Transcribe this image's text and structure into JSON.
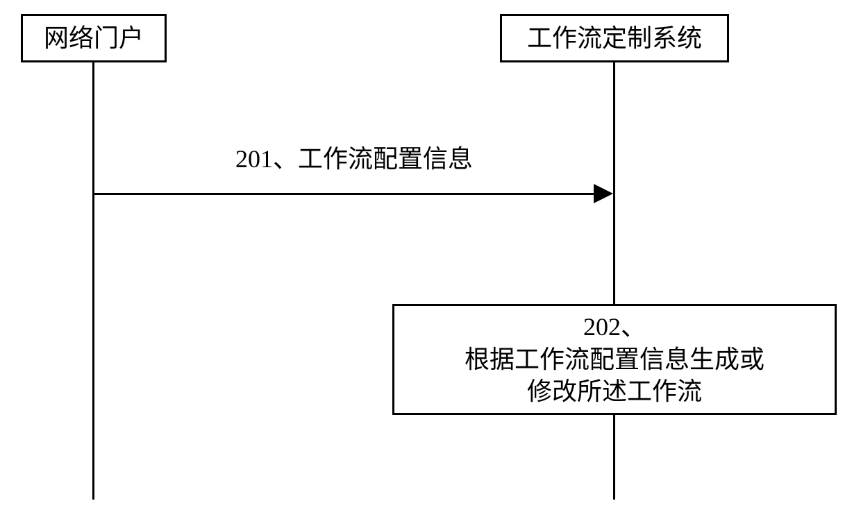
{
  "participants": {
    "left": {
      "title": "网络门户"
    },
    "right": {
      "title": "工作流定制系统"
    }
  },
  "messages": {
    "m201": {
      "label": "201、工作流配置信息"
    }
  },
  "steps": {
    "s202": {
      "line1": "202、",
      "line2": "根据工作流配置信息生成或",
      "line3": "修改所述工作流"
    }
  }
}
